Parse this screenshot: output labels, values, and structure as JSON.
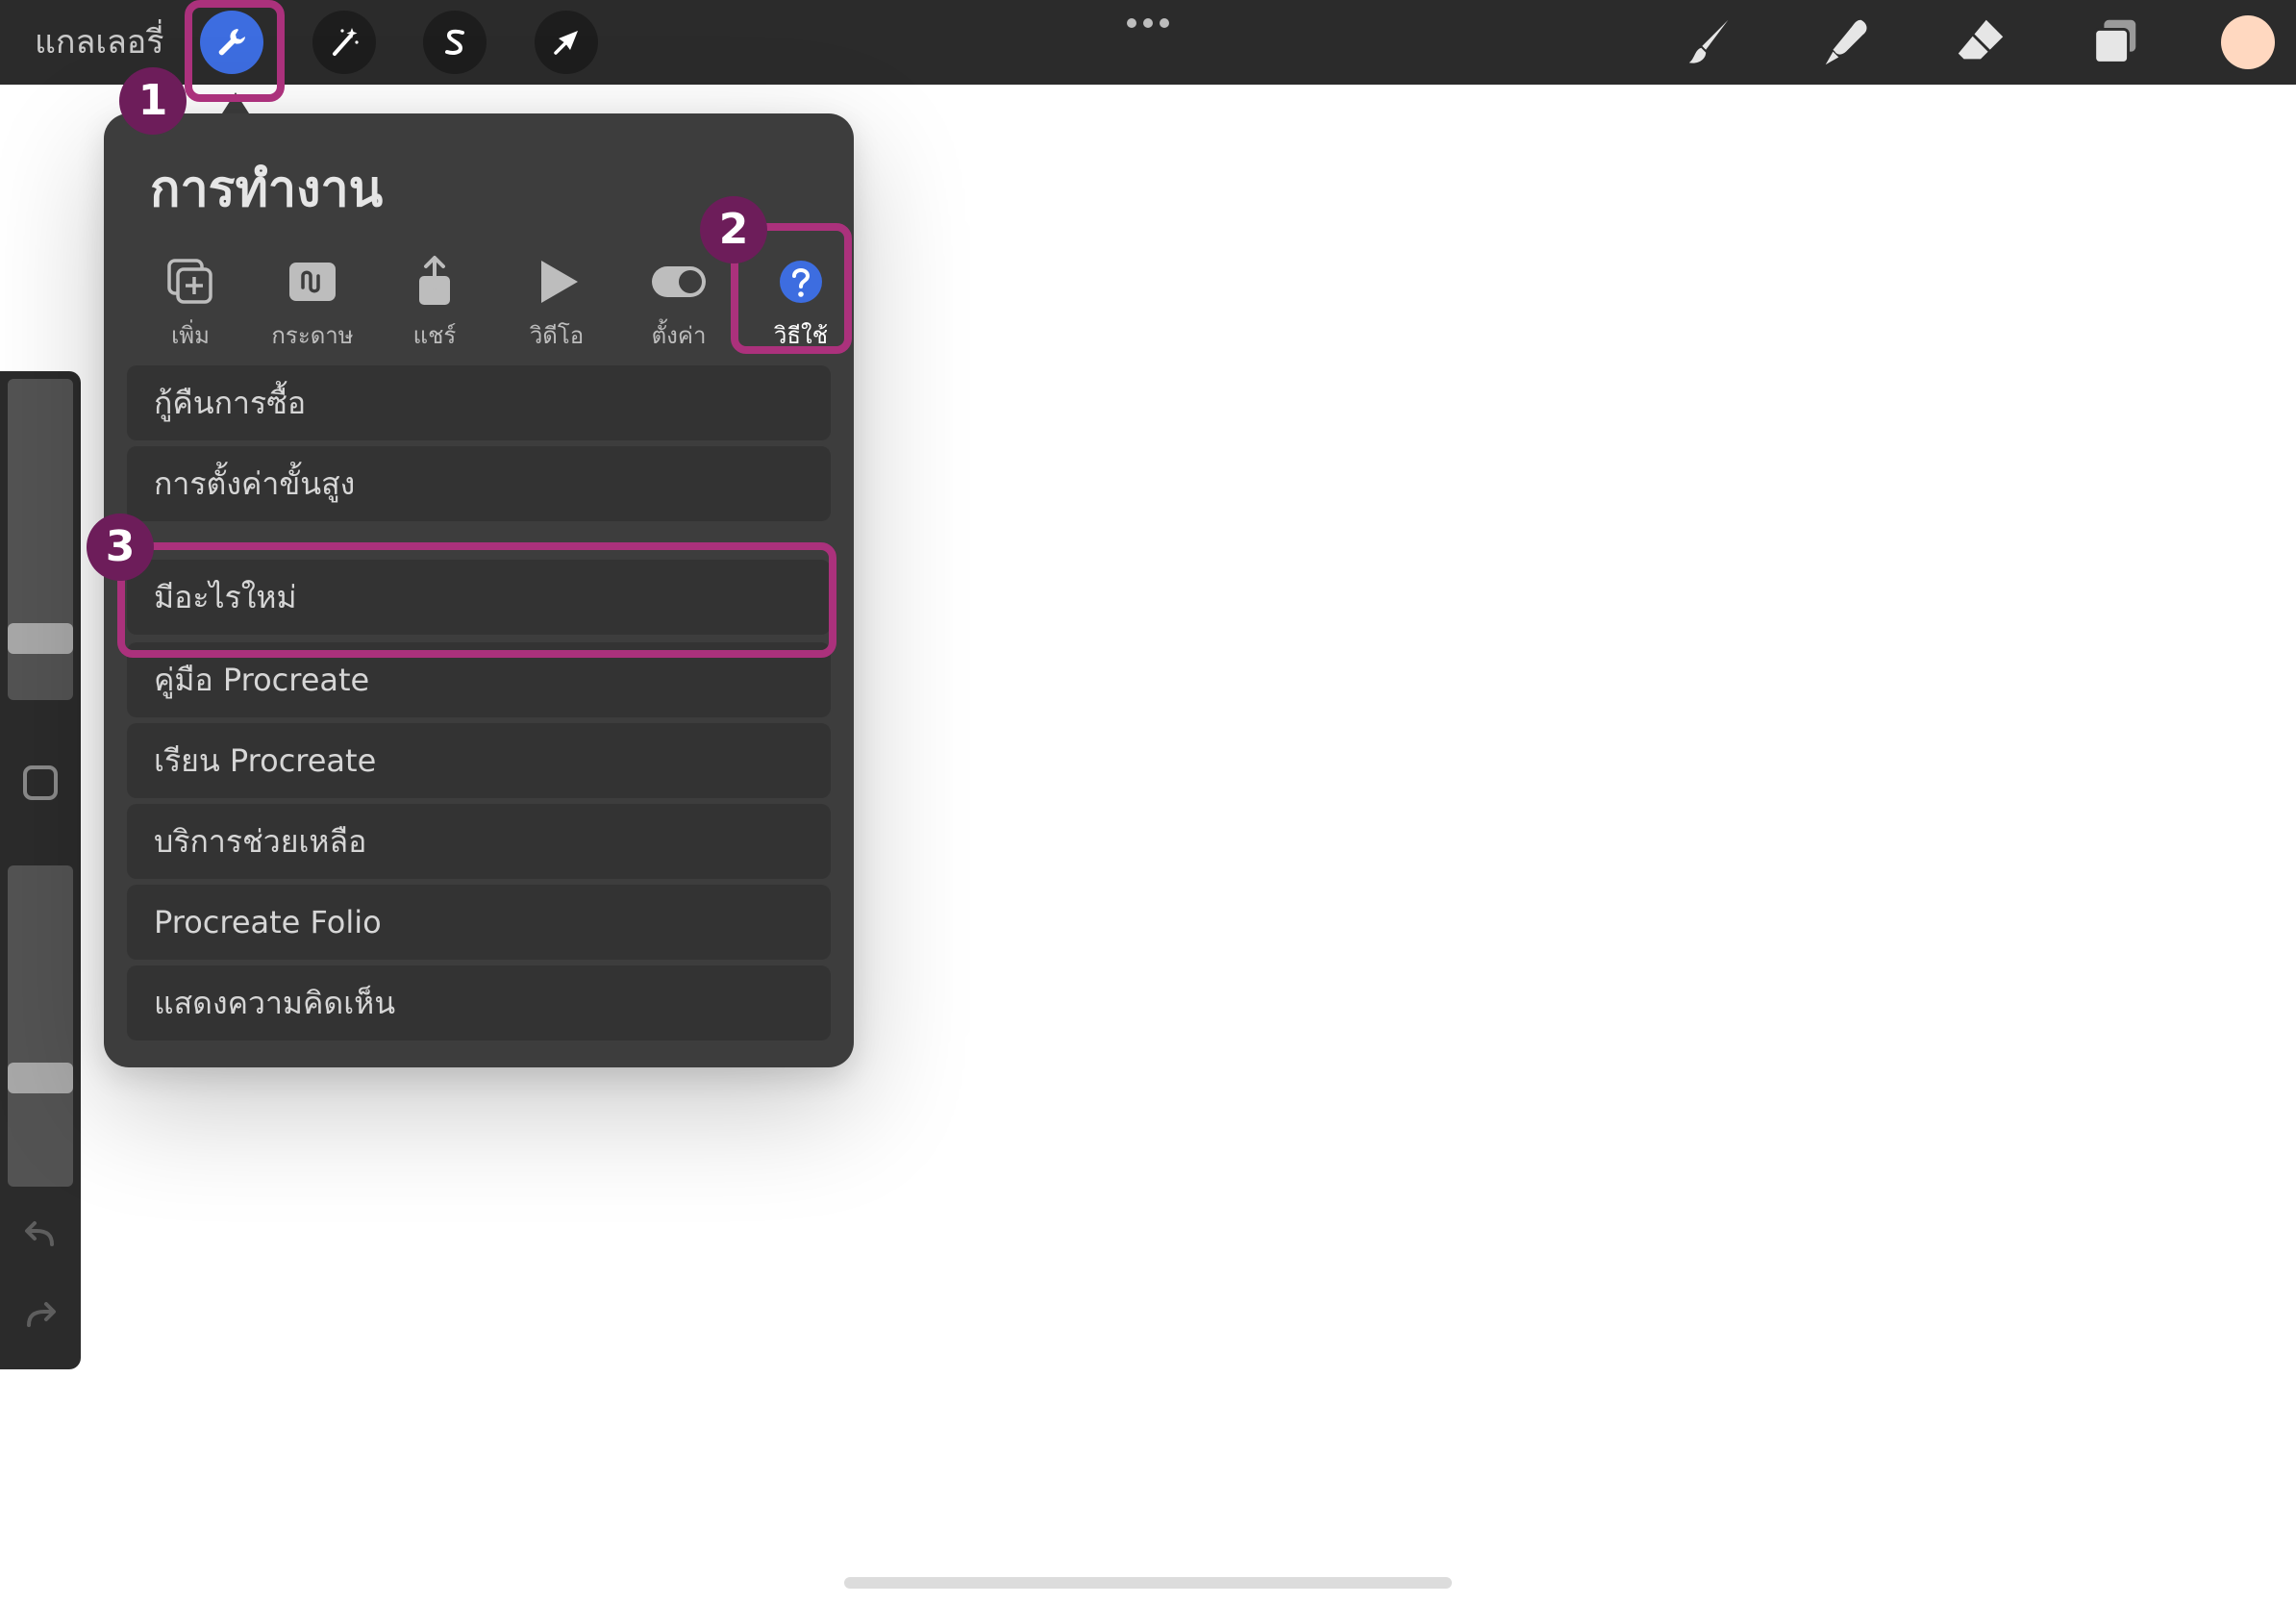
{
  "toolbar": {
    "gallery_label": "แกลเลอรี่",
    "left_tools": [
      {
        "name": "actions",
        "icon": "wrench-icon",
        "active": true
      },
      {
        "name": "adjustments",
        "icon": "magic-wand-icon"
      },
      {
        "name": "selection",
        "icon": "selection-s-icon"
      },
      {
        "name": "transform",
        "icon": "arrow-cursor-icon"
      }
    ],
    "right_tools": [
      "brush-icon",
      "smudge-icon",
      "eraser-icon",
      "layers-icon"
    ],
    "current_color": "#ffd8c0"
  },
  "panel": {
    "title": "การทำงาน",
    "tabs": [
      {
        "label": "เพิ่ม",
        "icon": "add-icon"
      },
      {
        "label": "กระดาษ",
        "icon": "canvas-icon"
      },
      {
        "label": "แชร์",
        "icon": "share-icon"
      },
      {
        "label": "วิดีโอ",
        "icon": "video-play-icon"
      },
      {
        "label": "ตั้งค่า",
        "icon": "toggle-icon"
      },
      {
        "label": "วิธีใช้",
        "icon": "help-icon",
        "active": true
      }
    ],
    "items": [
      "กู้คืนการซื้อ",
      "การตั้งค่าขั้นสูง",
      "มีอะไรใหม่",
      "คู่มือ Procreate",
      "เรียน Procreate",
      "บริการช่วยเหลือ",
      "Procreate Folio",
      "แสดงความคิดเห็น"
    ]
  },
  "sidebar": {
    "brush_size_level": 0.16,
    "opacity_level": 0.32
  },
  "annotations": {
    "badges": [
      "1",
      "2",
      "3"
    ],
    "highlight_color": "#ab317c",
    "badge_color": "#6d1d5a"
  },
  "colors": {
    "toolbar_bg": "#2b2b2b",
    "panel_bg": "#3d3d3d",
    "row_bg": "#333333",
    "active_blue": "#3d6de0"
  }
}
